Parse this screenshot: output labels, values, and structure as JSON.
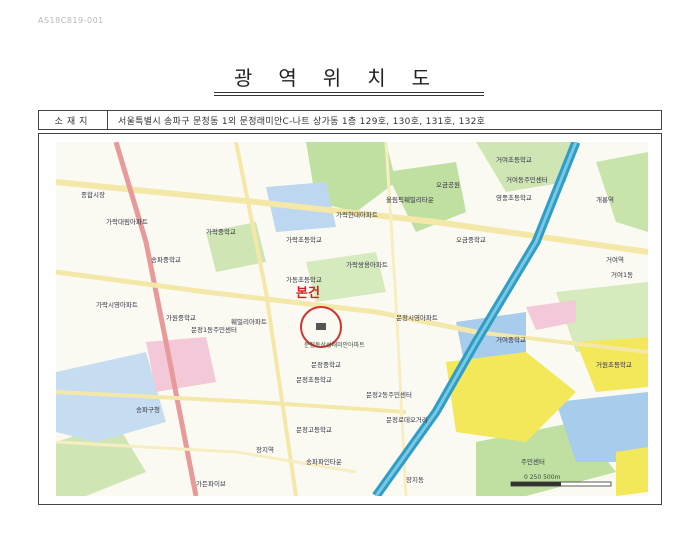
{
  "document": {
    "code": "AS18C819-001",
    "title": "광역위치도"
  },
  "address": {
    "label": "소재지",
    "value": "서울특별시 송파구 문정동 1외 문정래미안C-나트 상가동 1층 129호, 130호, 131호, 132호"
  },
  "map": {
    "subject_label": "본건",
    "subject_building": "문정동삼성래미안아파트",
    "scale_text": "0  250  500m",
    "colors": {
      "road_main": "#f4e8a8",
      "road_red": "#e89a9a",
      "expressway": "#2f9ec6",
      "green": "#bfe0a0",
      "water_blue": "#a8ccec",
      "yellow_zone": "#f2e85a",
      "subject_circle": "#d83030"
    },
    "places": [
      {
        "id": "p1",
        "text": "종합시장"
      },
      {
        "id": "p2",
        "text": "가락대림아파트"
      },
      {
        "id": "p3",
        "text": "가락초등학교"
      },
      {
        "id": "p4",
        "text": "송파중학교"
      },
      {
        "id": "p5",
        "text": "문정중학교"
      },
      {
        "id": "p6",
        "text": "가락쌍용아파트"
      },
      {
        "id": "p7",
        "text": "가원중학교"
      },
      {
        "id": "p8",
        "text": "문정1동주민센터"
      },
      {
        "id": "p9",
        "text": "훼밀리아파트"
      },
      {
        "id": "p10",
        "text": "가락시영아파트"
      },
      {
        "id": "p11",
        "text": "가동초등학교"
      },
      {
        "id": "p12",
        "text": "가락현대아파트"
      },
      {
        "id": "p13",
        "text": "가락중학교"
      },
      {
        "id": "p14",
        "text": "올림픽훼밀리타운"
      },
      {
        "id": "p15",
        "text": "문정시영아파트"
      },
      {
        "id": "p16",
        "text": "문정초등학교"
      },
      {
        "id": "p17",
        "text": "거여초등학교"
      },
      {
        "id": "p18",
        "text": "거여동주민센터"
      },
      {
        "id": "p19",
        "text": "영풍초등학교"
      },
      {
        "id": "p20",
        "text": "오금공원"
      },
      {
        "id": "p21",
        "text": "거여중학교"
      },
      {
        "id": "p22",
        "text": "거원초등학교"
      },
      {
        "id": "p23",
        "text": "송파구청"
      },
      {
        "id": "p24",
        "text": "문정2동주민센터"
      },
      {
        "id": "p25",
        "text": "장지역"
      },
      {
        "id": "p26",
        "text": "가든파이브"
      },
      {
        "id": "p27",
        "text": "송파파인타운"
      },
      {
        "id": "p28",
        "text": "문정고등학교"
      },
      {
        "id": "p29",
        "text": "장지동"
      },
      {
        "id": "p30",
        "text": "거여역"
      },
      {
        "id": "p31",
        "text": "주민센터"
      },
      {
        "id": "p32",
        "text": "오금중학교"
      },
      {
        "id": "p33",
        "text": "개롱역"
      },
      {
        "id": "p34",
        "text": "거여1동"
      },
      {
        "id": "p35",
        "text": "문정로데오거리"
      }
    ]
  }
}
